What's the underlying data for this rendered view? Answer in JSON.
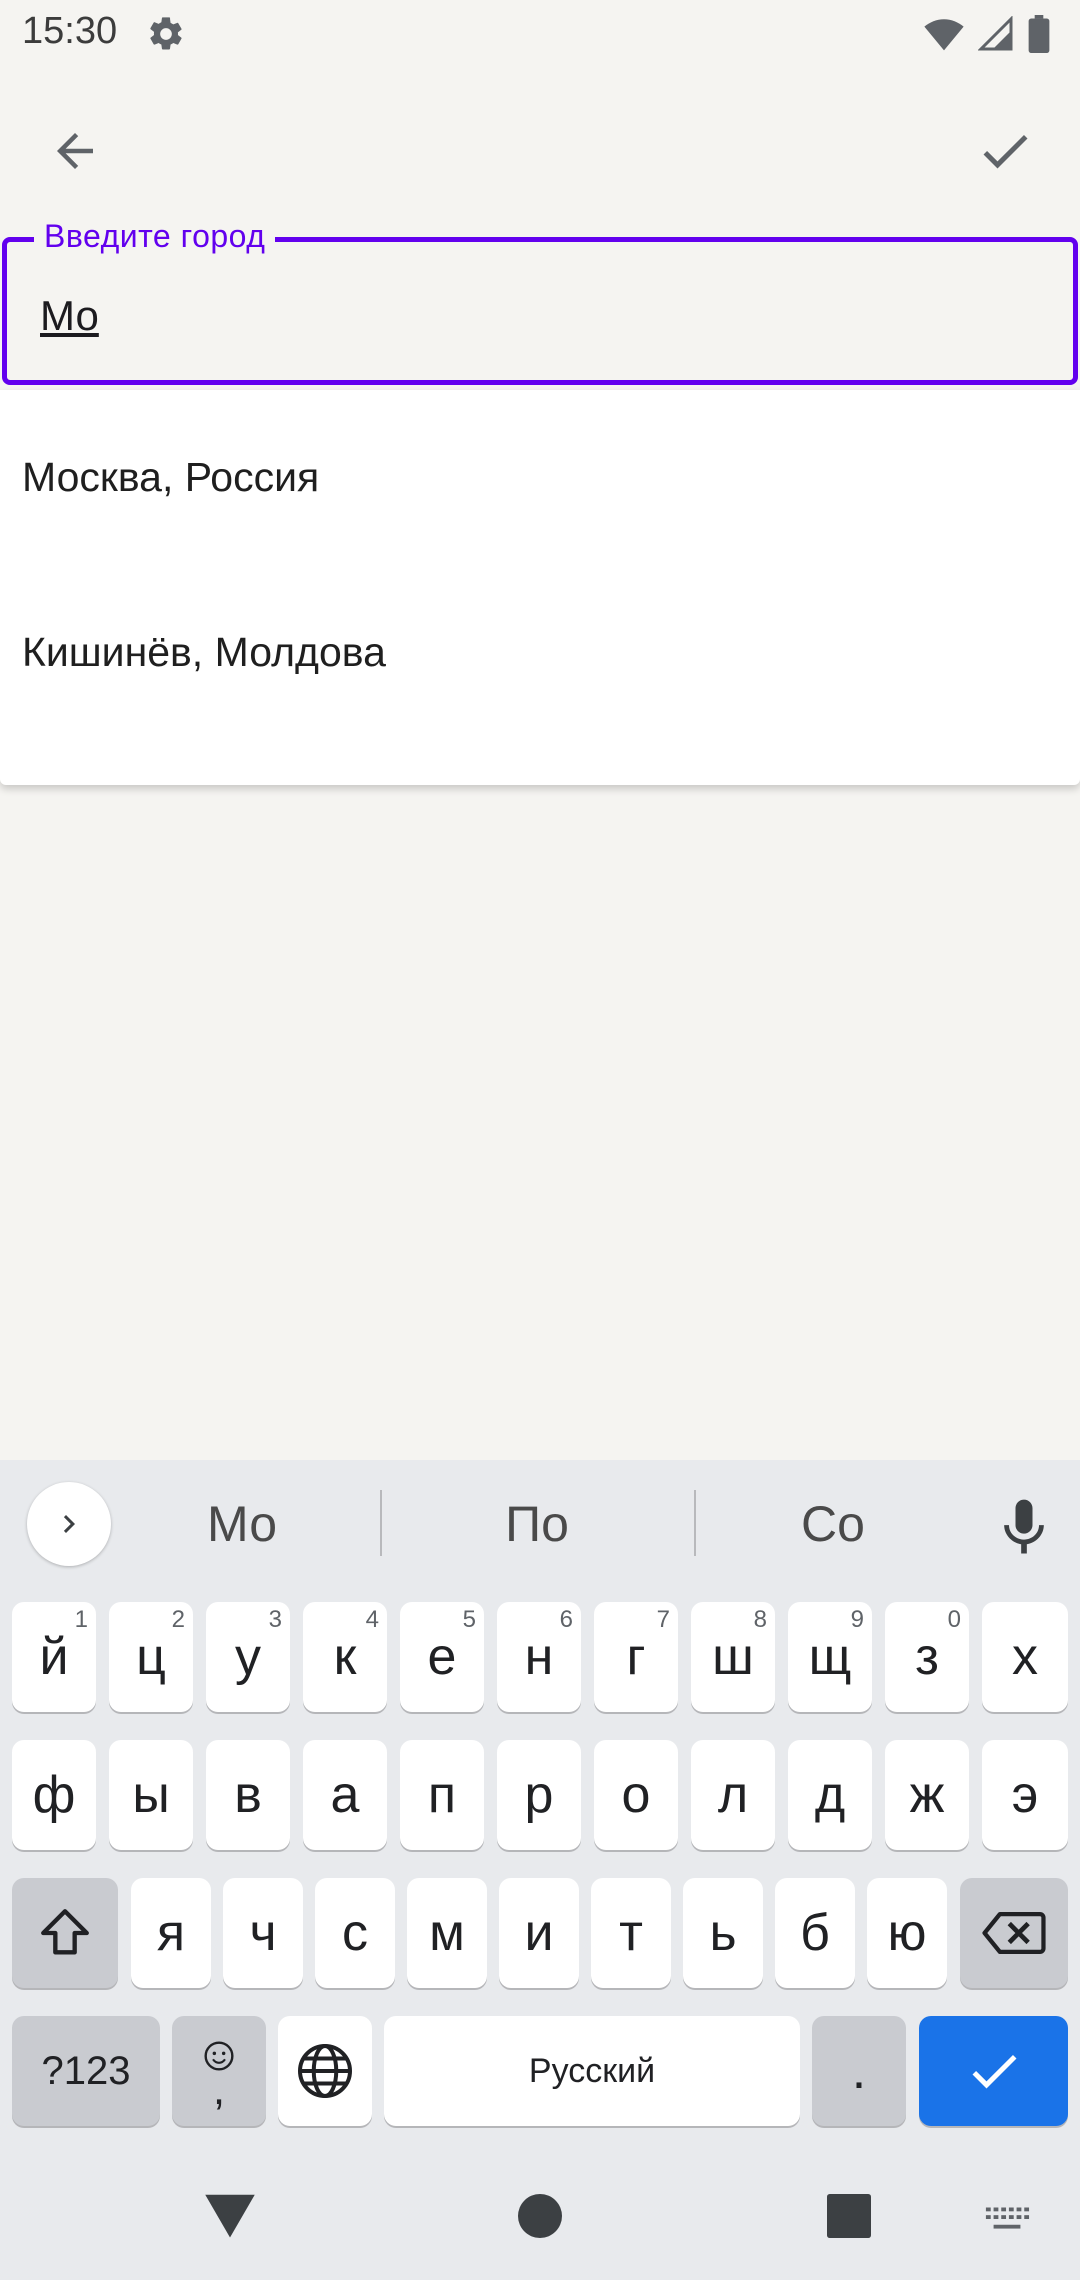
{
  "status_bar": {
    "time": "15:30",
    "icons": [
      "settings-icon",
      "wifi-icon",
      "signal-icon",
      "battery-icon"
    ]
  },
  "app_bar": {
    "back_icon": "arrow-back-icon",
    "confirm_icon": "check-icon"
  },
  "city_field": {
    "label": "Введите город",
    "value": "Мо"
  },
  "suggestions_dropdown": {
    "items": [
      "Москва, Россия",
      "Кишинёв, Молдова"
    ]
  },
  "keyboard": {
    "suggestions": [
      "Мо",
      "По",
      "Со"
    ],
    "row1": [
      {
        "ch": "й",
        "hint": "1"
      },
      {
        "ch": "ц",
        "hint": "2"
      },
      {
        "ch": "у",
        "hint": "3"
      },
      {
        "ch": "к",
        "hint": "4"
      },
      {
        "ch": "е",
        "hint": "5"
      },
      {
        "ch": "н",
        "hint": "6"
      },
      {
        "ch": "г",
        "hint": "7"
      },
      {
        "ch": "ш",
        "hint": "8"
      },
      {
        "ch": "щ",
        "hint": "9"
      },
      {
        "ch": "з",
        "hint": "0"
      },
      {
        "ch": "х",
        "hint": ""
      }
    ],
    "row2": [
      "ф",
      "ы",
      "в",
      "а",
      "п",
      "р",
      "о",
      "л",
      "д",
      "ж",
      "э"
    ],
    "row3": [
      "я",
      "ч",
      "с",
      "м",
      "и",
      "т",
      "ь",
      "б",
      "ю"
    ],
    "symbols_label": "?123",
    "emoji_comma": ",",
    "space_label": "Русский",
    "period_label": "."
  },
  "colors": {
    "accent": "#6200ee",
    "enter_key": "#1a73e8",
    "background": "#f5f4f1"
  }
}
